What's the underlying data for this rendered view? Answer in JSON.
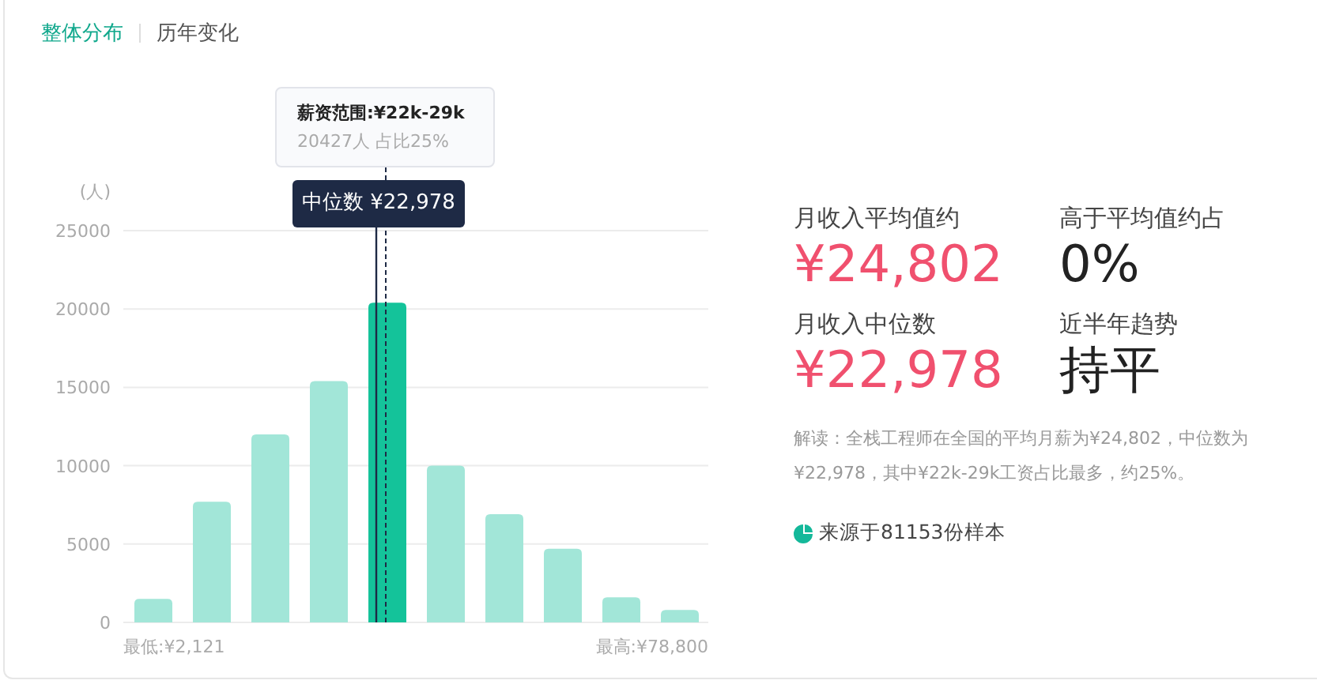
{
  "tabs": [
    {
      "label": "整体分布",
      "selected": true
    },
    {
      "label": "历年变化",
      "selected": false
    }
  ],
  "chart": {
    "bars": [
      {
        "selected": false
      },
      {
        "selected": false
      },
      {
        "selected": false
      },
      {
        "selected": false
      },
      {
        "selected": true
      },
      {
        "selected": false
      },
      {
        "selected": false
      },
      {
        "selected": false
      },
      {
        "selected": false
      },
      {
        "selected": false
      }
    ],
    "tooltip": {
      "title": "薪资范围:¥22k-29k",
      "detail": "20427人  占比25%"
    },
    "median_label": "中位数 ¥22,978",
    "min_label": "最低:¥2,121",
    "max_label": "最高:¥78,800",
    "chart_data": {
      "type": "bar",
      "grid": true,
      "ylabel": "(人)",
      "ylim": [
        0,
        25000
      ],
      "yticks": [
        0,
        5000,
        10000,
        15000,
        20000,
        25000
      ],
      "values": [
        1500,
        7700,
        12000,
        15400,
        20400,
        10000,
        6900,
        4700,
        1600,
        800
      ]
    }
  },
  "stats": [
    {
      "label": "月收入平均值约",
      "value": "¥24,802",
      "kind": "money"
    },
    {
      "label": "高于平均值约占",
      "value": "0%",
      "kind": "plain"
    },
    {
      "label": "月收入中位数",
      "value": "¥22,978",
      "kind": "money"
    },
    {
      "label": "近半年趋势",
      "value": "持平",
      "kind": "plain"
    }
  ],
  "note": "解读：全栈工程师在全国的平均月薪为¥24,802，中位数为¥22,978，其中¥22k-29k工资占比最多，约25%。",
  "source": "来源于81153份样本"
}
